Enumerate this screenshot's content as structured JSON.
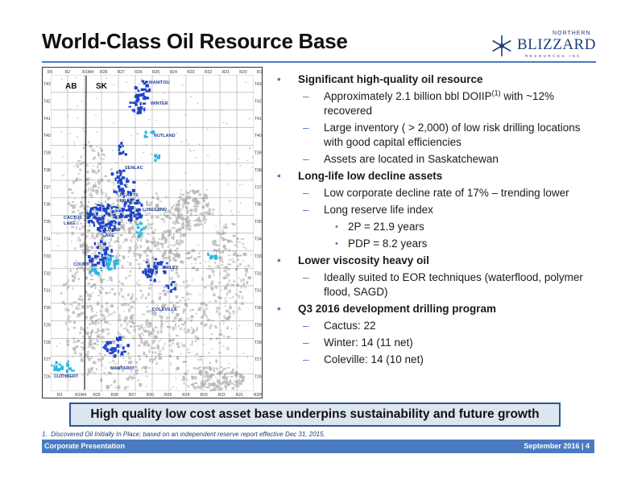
{
  "slide": {
    "title": "World-Class Oil Resource Base",
    "logo": {
      "top_text": "NORTHERN",
      "name": "BLIZZARD",
      "sub_text": "RESOURCES INC"
    }
  },
  "map": {
    "province_labels": [
      "AB",
      "SK"
    ],
    "range_labels_top": [
      "R5",
      "R2",
      "R1W4",
      "R28",
      "R27",
      "R26",
      "R25",
      "R24",
      "R23",
      "R22",
      "R21",
      "R20",
      "R19W3"
    ],
    "range_labels_bottom": [
      "R2",
      "R1W4",
      "R29",
      "R28",
      "R27",
      "R26",
      "R25",
      "R24",
      "R23",
      "R22",
      "R21",
      "R20W3"
    ],
    "township_labels_left": [
      "T43",
      "T42",
      "T41",
      "T40",
      "T39",
      "T38",
      "T37",
      "T36",
      "T35",
      "T34",
      "T33",
      "T32",
      "T31",
      "T30",
      "T29",
      "T28",
      "T27",
      "T26"
    ],
    "township_labels_right": [
      "T43",
      "T42",
      "T41",
      "T40",
      "T39",
      "T38",
      "T37",
      "T36",
      "T35",
      "T34",
      "T33",
      "T32",
      "T31",
      "T30",
      "T29",
      "T28",
      "T27",
      "T26"
    ],
    "areas": [
      "MANITOU",
      "WINTER",
      "RUTLAND",
      "SENLAC",
      "HEARTS HILL",
      "LUSELAND",
      "CACTUS LAKE",
      "PLOVER LAKE",
      "COURT",
      "SMILEY",
      "COLEVILLE",
      "MANTARIO",
      "CUTHBERT"
    ]
  },
  "bullets": [
    {
      "level": 1,
      "text": "Significant high-quality oil resource"
    },
    {
      "level": 2,
      "text": "Approximately 2.1 billion bbl DOIIP",
      "sup": "(1)",
      "text_after": " with ~12% recovered"
    },
    {
      "level": 2,
      "text": "Large inventory ( > 2,000) of low risk drilling locations with good capital efficiencies"
    },
    {
      "level": 2,
      "text": "Assets are located in Saskatchewan"
    },
    {
      "level": 1,
      "text": "Long-life low decline assets"
    },
    {
      "level": 2,
      "text": "Low corporate decline rate of 17% – trending lower"
    },
    {
      "level": 2,
      "text": "Long reserve life index"
    },
    {
      "level": 3,
      "text": "2P = 21.9 years"
    },
    {
      "level": 3,
      "text": "PDP = 8.2 years"
    },
    {
      "level": 1,
      "text": "Lower viscosity heavy oil"
    },
    {
      "level": 2,
      "text": "Ideally suited to EOR techniques (waterflood, polymer flood, SAGD)"
    },
    {
      "level": 1,
      "text": "Q3 2016 development drilling program"
    },
    {
      "level": 2,
      "text": "Cactus: 22"
    },
    {
      "level": 2,
      "text": "Winter: 14 (11 net)"
    },
    {
      "level": 2,
      "text": "Coleville: 14 (10 net)"
    }
  ],
  "banner": "High quality low cost asset base underpins sustainability and future growth",
  "footnote": {
    "number": "1.",
    "text": "Discovered Oil Initially In Place; based on an independent reserve report effective Dec 31, 2015."
  },
  "footer": {
    "left": "Corporate Presentation",
    "date": "September 2016",
    "separator": "|",
    "page": "4"
  },
  "colors": {
    "accent": "#4a7bc1",
    "banner_fill": "#dce6f1",
    "banner_border": "#2f5597",
    "land_blue": "#1f45c8",
    "land_cyan": "#29b6e0",
    "well_gray": "#b4b4b4"
  }
}
